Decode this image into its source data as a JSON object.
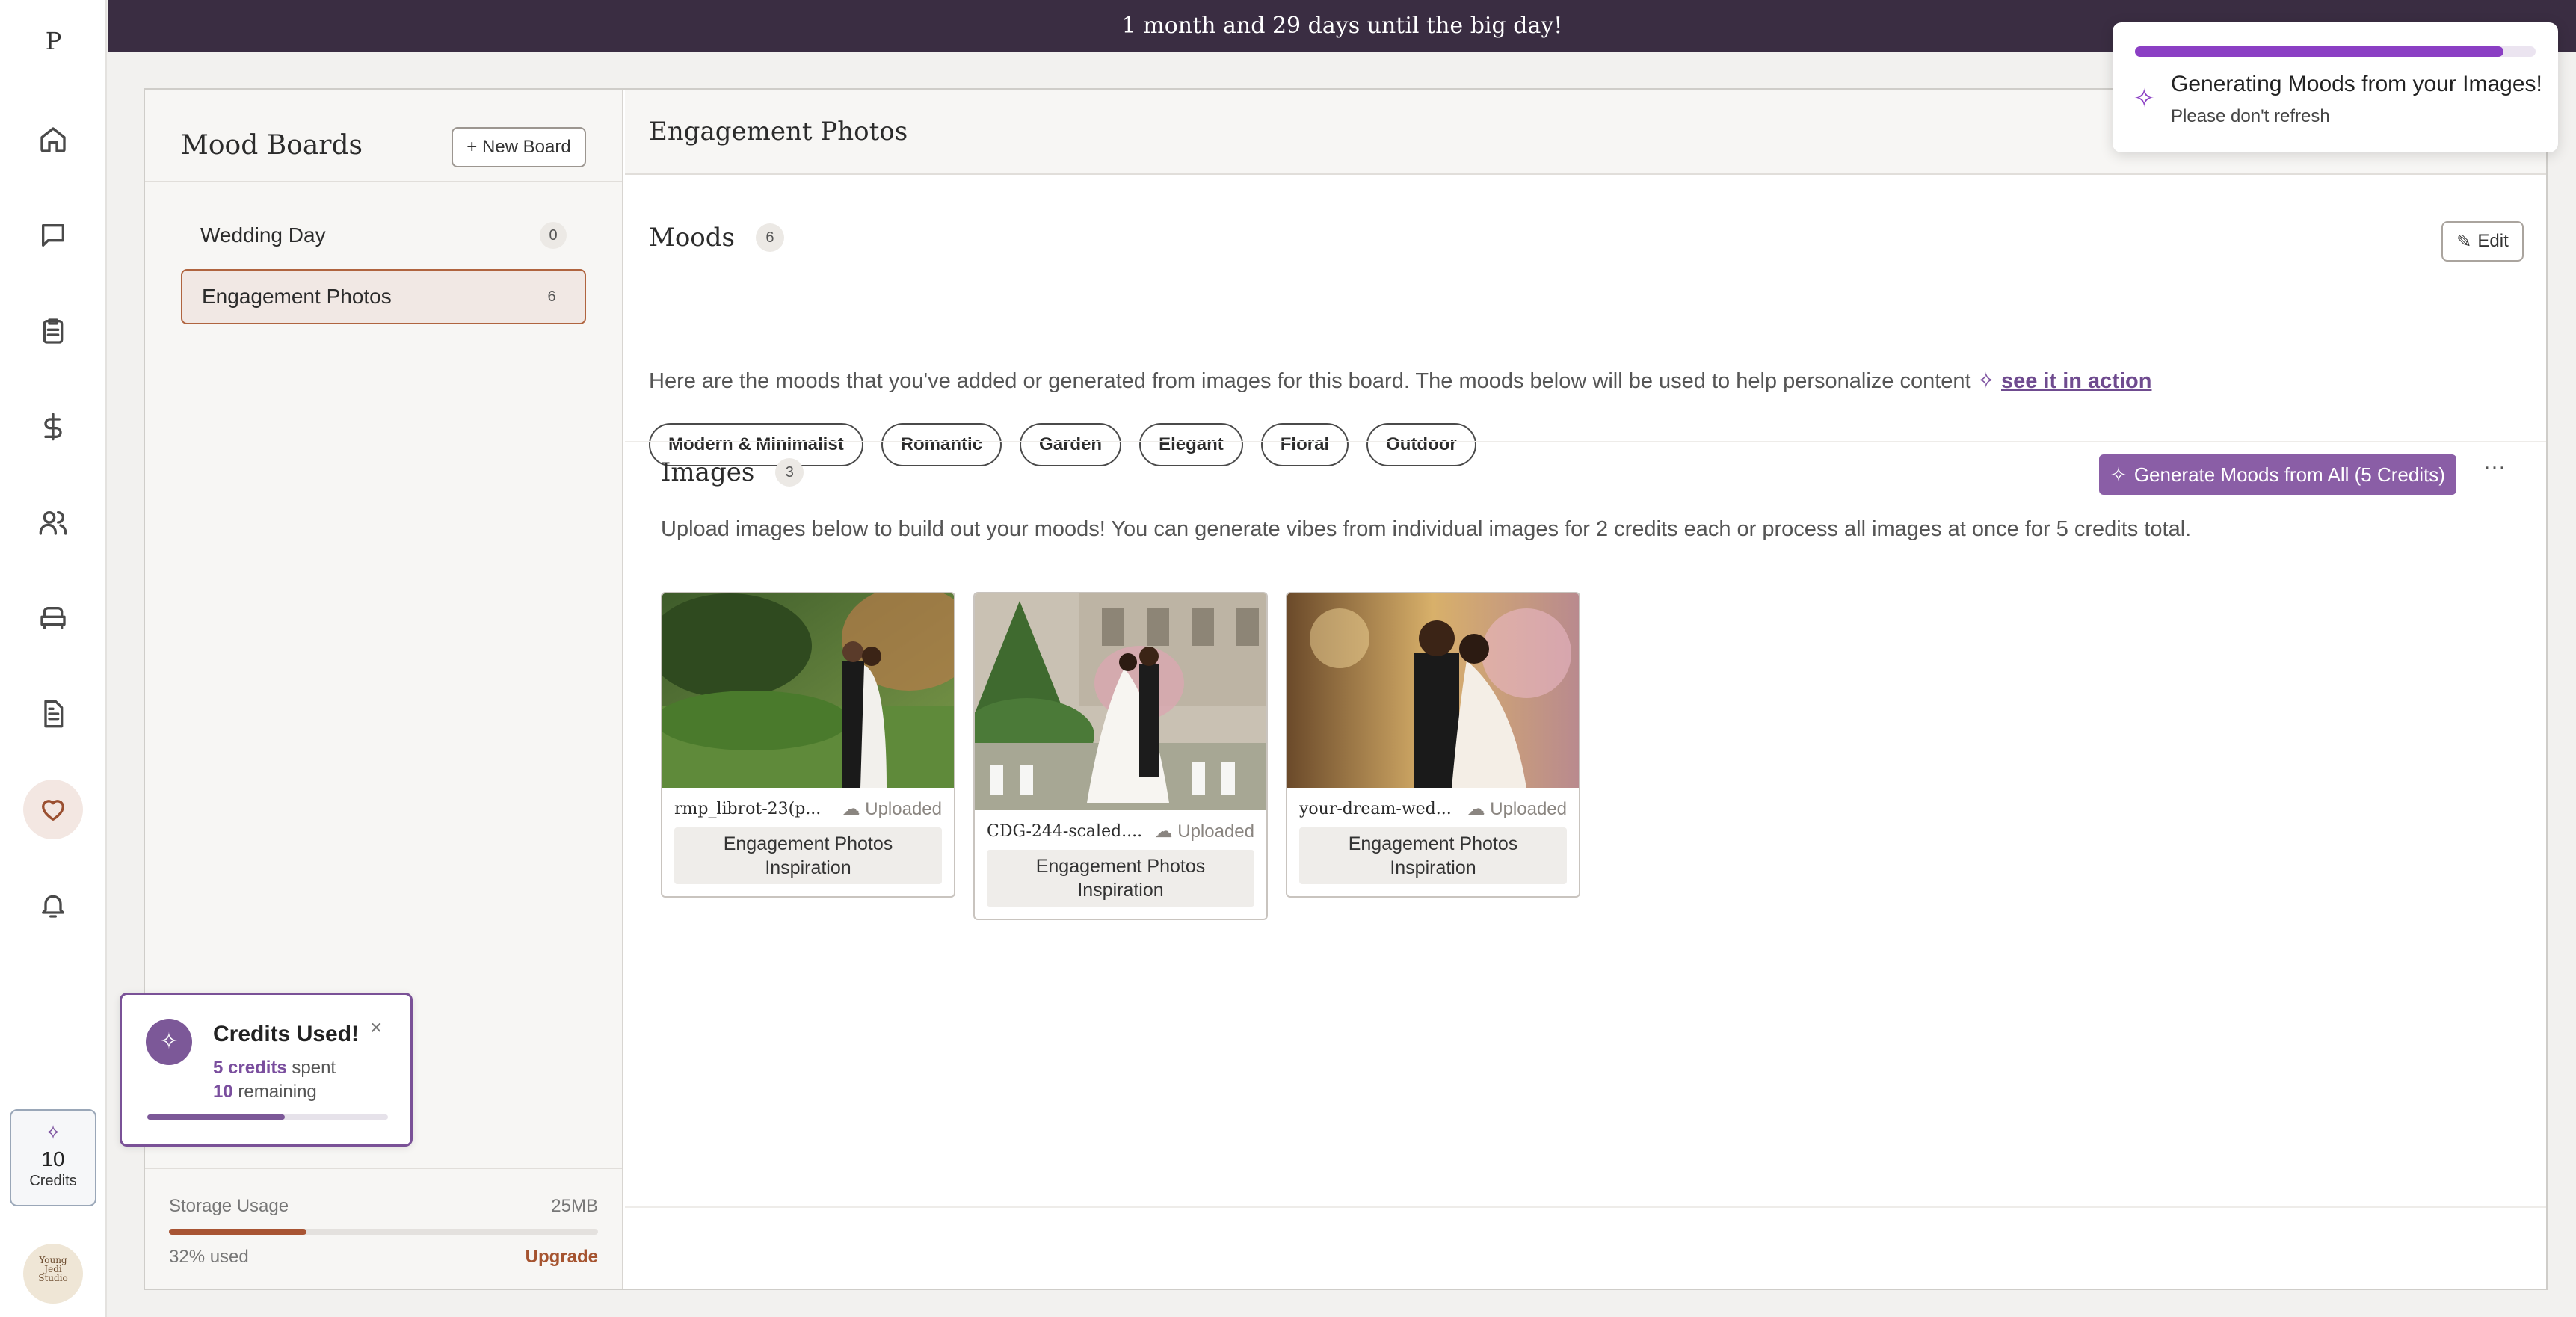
{
  "app": {
    "logo_letter": "P"
  },
  "banner": {
    "text": "1 month and 29 days until the big day!"
  },
  "nav": [
    {
      "name": "home-icon",
      "active": false
    },
    {
      "name": "messages-icon",
      "active": false
    },
    {
      "name": "checklist-icon",
      "active": false
    },
    {
      "name": "budget-icon",
      "active": false
    },
    {
      "name": "guests-icon",
      "active": false
    },
    {
      "name": "vendors-icon",
      "active": false
    },
    {
      "name": "documents-icon",
      "active": false
    },
    {
      "name": "heart-icon",
      "active": true
    },
    {
      "name": "bell-icon",
      "active": false
    }
  ],
  "credits": {
    "count": "10",
    "label": "Credits"
  },
  "avatar": {
    "line1": "Young",
    "line2": "Jedi",
    "line3": "Studio"
  },
  "boards": {
    "title": "Mood Boards",
    "new_button": "+ New Board",
    "items": [
      {
        "label": "Wedding Day",
        "count": "0"
      },
      {
        "label": "Engagement Photos",
        "count": "6"
      }
    ],
    "storage": {
      "label": "Storage Usage",
      "size": "25MB",
      "used_text": "32% used",
      "used_fraction": 0.32,
      "upgrade": "Upgrade"
    }
  },
  "content": {
    "title": "Engagement Photos",
    "moods": {
      "title": "Moods",
      "count": "6",
      "edit": "Edit",
      "description": "Here are the moods that you've added or generated from images for this board. The moods below will be used to help personalize content",
      "link": "see it in action",
      "tags": [
        "Modern & Minimalist",
        "Romantic",
        "Garden",
        "Elegant",
        "Floral",
        "Outdoor"
      ]
    },
    "images": {
      "title": "Images",
      "count": "3",
      "generate_button": "Generate Moods from All (5 Credits)",
      "more": "···",
      "description": "Upload images below to build out your moods! You can generate vibes from individual images for 2 credits each or process all images at once for 5 credits total.",
      "cards": [
        {
          "filename": "rmp_librot-23(p...",
          "status": "Uploaded",
          "board": "Engagement Photos Inspiration"
        },
        {
          "filename": "CDG-244-scaled....",
          "status": "Uploaded",
          "board": "Engagement Photos Inspiration"
        },
        {
          "filename": "your-dream-wed...",
          "status": "Uploaded",
          "board": "Engagement Photos Inspiration"
        }
      ]
    }
  },
  "toast_generating": {
    "title": "Generating Moods from your Images!",
    "subtitle": "Please don't refresh",
    "progress_fraction": 0.92
  },
  "toast_credits": {
    "title": "Credits Used!",
    "spent_value": "5 credits",
    "spent_suffix": " spent",
    "remaining_value": "10",
    "remaining_suffix": " remaining",
    "progress_fraction": 0.57,
    "close": "×"
  },
  "colors": {
    "banner": "#3a2d42",
    "accent_purple": "#8a5ea6",
    "accent_rust": "#a5532f"
  }
}
